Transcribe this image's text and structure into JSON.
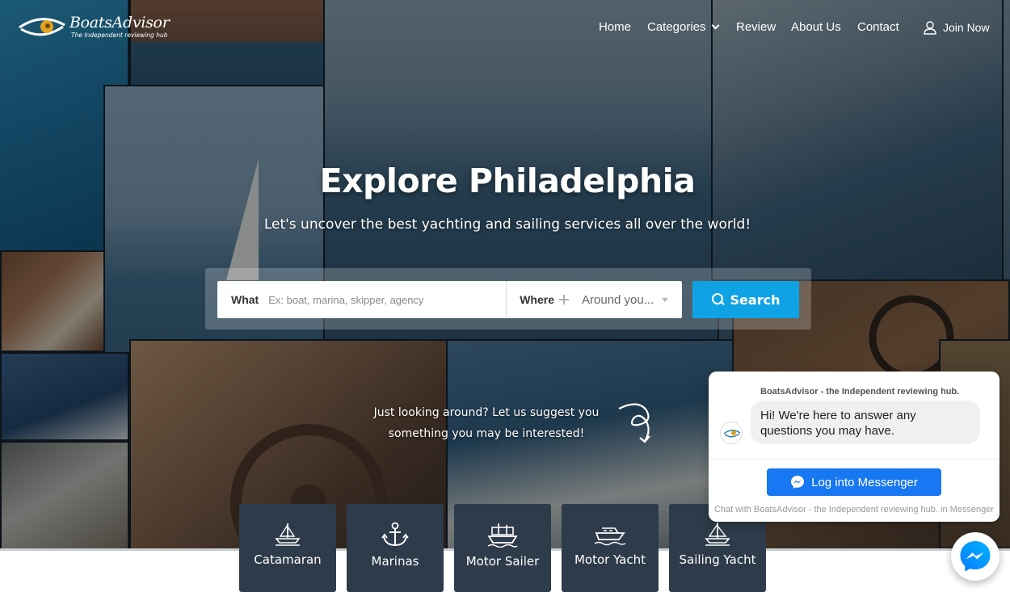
{
  "brand": {
    "name": "BoatsAdvisor",
    "tagline": "The Independent reviewing hub"
  },
  "nav": {
    "items": [
      {
        "label": "Home"
      },
      {
        "label": "Categories"
      },
      {
        "label": "Review"
      },
      {
        "label": "About Us"
      },
      {
        "label": "Contact"
      }
    ],
    "join_label": "Join Now"
  },
  "hero": {
    "title": "Explore Philadelphia",
    "subtitle": "Let's uncover the best yachting and sailing services all over the world!"
  },
  "search": {
    "what_label": "What",
    "what_placeholder": "Ex: boat, marina, skipper, agency",
    "where_label": "Where",
    "where_value": "Around you...",
    "button_label": "Search"
  },
  "suggestion": {
    "line1": "Just looking around? Let us suggest you",
    "line2": "something you may be interested!"
  },
  "categories": [
    {
      "label": "Catamaran",
      "icon": "catamaran-icon"
    },
    {
      "label": "Marinas",
      "icon": "anchor-icon"
    },
    {
      "label": "Motor Sailer",
      "icon": "motor-sailer-icon"
    },
    {
      "label": "Motor Yacht",
      "icon": "motor-yacht-icon"
    },
    {
      "label": "Sailing Yacht",
      "icon": "sailing-yacht-icon"
    }
  ],
  "chat": {
    "header": "BoatsAdvisor - the Independent reviewing hub.",
    "message": "Hi! We're here to answer any questions you may have.",
    "button_label": "Log into Messenger",
    "footer": "Chat with BoatsAdvisor - the Independent reviewing hub. in Messenger"
  },
  "colors": {
    "accent": "#0fa3e6",
    "category_bg": "#2e3b4a",
    "messenger": "#1877f2"
  }
}
